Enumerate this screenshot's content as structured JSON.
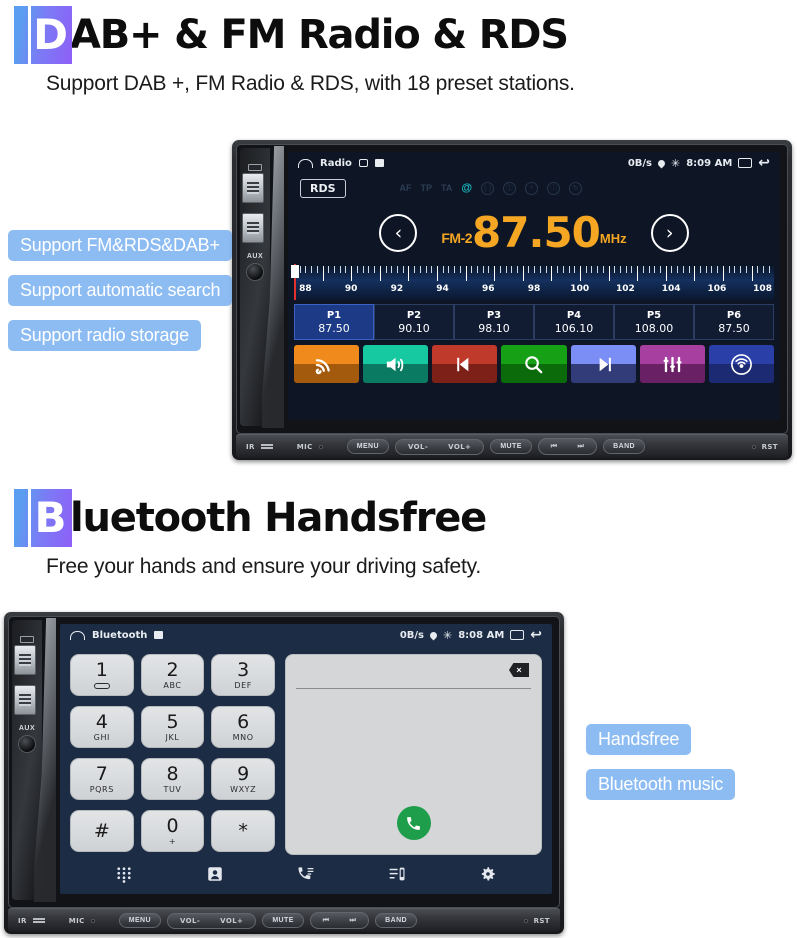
{
  "sections": [
    {
      "badge_letter": "D",
      "title": "AB+ & FM Radio & RDS",
      "subtitle": "Support DAB +, FM Radio & RDS, with 18 preset stations."
    },
    {
      "badge_letter": "B",
      "title": "luetooth Handsfree",
      "subtitle": "Free your hands and ensure your driving safety."
    }
  ],
  "radio": {
    "statusbar": {
      "home_icon": "home-icon",
      "app_title": "Radio",
      "camera_icon": "camera-icon",
      "sd_icon": "sd-card-icon",
      "data_rate": "0B/s",
      "location_icon": "location-pin-icon",
      "bluetooth_icon": "✳",
      "time": "8:09 AM",
      "recents_icon": "recents-icon",
      "back_icon": "↩"
    },
    "rds_label": "RDS",
    "rds_icons": [
      {
        "name": "af-toggle",
        "label": "AF",
        "active": false
      },
      {
        "name": "tp-toggle",
        "label": "TP",
        "active": false
      },
      {
        "name": "ta-toggle",
        "label": "TA",
        "active": false
      },
      {
        "name": "rds-eon-icon",
        "label": "@",
        "active": true
      },
      {
        "name": "signal-icon",
        "label": "(·)",
        "active": false
      },
      {
        "name": "pty-icon",
        "label": "⓵",
        "active": false
      },
      {
        "name": "search-icon",
        "label": "⌕",
        "active": false
      },
      {
        "name": "info-icon",
        "label": "ⓘ",
        "active": false
      },
      {
        "name": "refresh-icon",
        "label": "↻",
        "active": false
      }
    ],
    "prev_arrow": "‹",
    "next_arrow": "›",
    "band": "FM-2",
    "frequency": "87.50",
    "unit": "MHz",
    "scale": {
      "min": 87.5,
      "max": 108.5,
      "labels": [
        88,
        90,
        92,
        94,
        96,
        98,
        100,
        102,
        104,
        106,
        108
      ],
      "marker_value": 87.5
    },
    "presets": [
      {
        "name": "P1",
        "freq": "87.50",
        "active": true
      },
      {
        "name": "P2",
        "freq": "90.10",
        "active": false
      },
      {
        "name": "P3",
        "freq": "98.10",
        "active": false
      },
      {
        "name": "P4",
        "freq": "106.10",
        "active": false
      },
      {
        "name": "P5",
        "freq": "108.00",
        "active": false
      },
      {
        "name": "P6",
        "freq": "87.50",
        "active": false
      }
    ],
    "actions": [
      {
        "name": "dab-icon",
        "color_top": "#f08a1c",
        "color_bottom": "#a35a0d"
      },
      {
        "name": "volume-icon",
        "color_top": "#17c9a0",
        "color_bottom": "#0b7a63"
      },
      {
        "name": "previous-icon",
        "color_top": "#c03a2b",
        "color_bottom": "#7d2118"
      },
      {
        "name": "scan-search-icon",
        "color_top": "#16a016",
        "color_bottom": "#0b6b0b"
      },
      {
        "name": "next-icon",
        "color_top": "#7b8ef5",
        "color_bottom": "#323c79"
      },
      {
        "name": "equalizer-icon",
        "color_top": "#a63fa0",
        "color_bottom": "#6a2064"
      },
      {
        "name": "radio-band-icon",
        "color_top": "#2b3fa8",
        "color_bottom": "#1b2a72"
      }
    ],
    "callouts": [
      "Support FM&RDS&DAB+",
      "Support automatic search",
      "Support radio storage"
    ],
    "bezel": {
      "ir": "IR",
      "mic": "MIC",
      "menu": "MENU",
      "vol_down": "VOL-",
      "vol_up": "VOL+",
      "mute": "MUTE",
      "prev": "⏮",
      "next": "⏭",
      "band": "BAND",
      "rst": "RST"
    },
    "aux_label": "AUX"
  },
  "bluetooth": {
    "statusbar": {
      "app_title": "Bluetooth",
      "sd_icon": "sd-card-icon",
      "data_rate": "0B/s",
      "time": "8:08 AM",
      "bluetooth_icon": "✳",
      "back_icon": "↩"
    },
    "keys": [
      {
        "digit": "1",
        "sub": "",
        "voicemail": true
      },
      {
        "digit": "2",
        "sub": "ABC"
      },
      {
        "digit": "3",
        "sub": "DEF"
      },
      {
        "digit": "4",
        "sub": "GHI"
      },
      {
        "digit": "5",
        "sub": "JKL"
      },
      {
        "digit": "6",
        "sub": "MNO"
      },
      {
        "digit": "7",
        "sub": "PQRS"
      },
      {
        "digit": "8",
        "sub": "TUV"
      },
      {
        "digit": "9",
        "sub": "WXYZ"
      },
      {
        "digit": "#",
        "sub": ""
      },
      {
        "digit": "0",
        "sub": "+"
      },
      {
        "digit": "*",
        "sub": ""
      }
    ],
    "number_value": "",
    "backspace_icon": "×",
    "call_icon": "✆",
    "call_color": "#1e9e4a",
    "nav": [
      {
        "name": "nav-dialpad",
        "icon": "dialpad-icon"
      },
      {
        "name": "nav-contacts",
        "icon": "contacts-icon"
      },
      {
        "name": "nav-call-log",
        "icon": "call-log-icon"
      },
      {
        "name": "nav-phonebook",
        "icon": "phonebook-icon"
      },
      {
        "name": "nav-settings",
        "icon": "gear-icon"
      }
    ],
    "callouts": [
      "Handsfree",
      "Bluetooth music"
    ],
    "bezel": {
      "ir": "IR",
      "mic": "MIC",
      "menu": "MENU",
      "vol_down": "VOL-",
      "vol_up": "VOL+",
      "mute": "MUTE",
      "prev": "⏮",
      "next": "⏭",
      "band": "BAND",
      "rst": "RST"
    },
    "aux_label": "AUX"
  }
}
